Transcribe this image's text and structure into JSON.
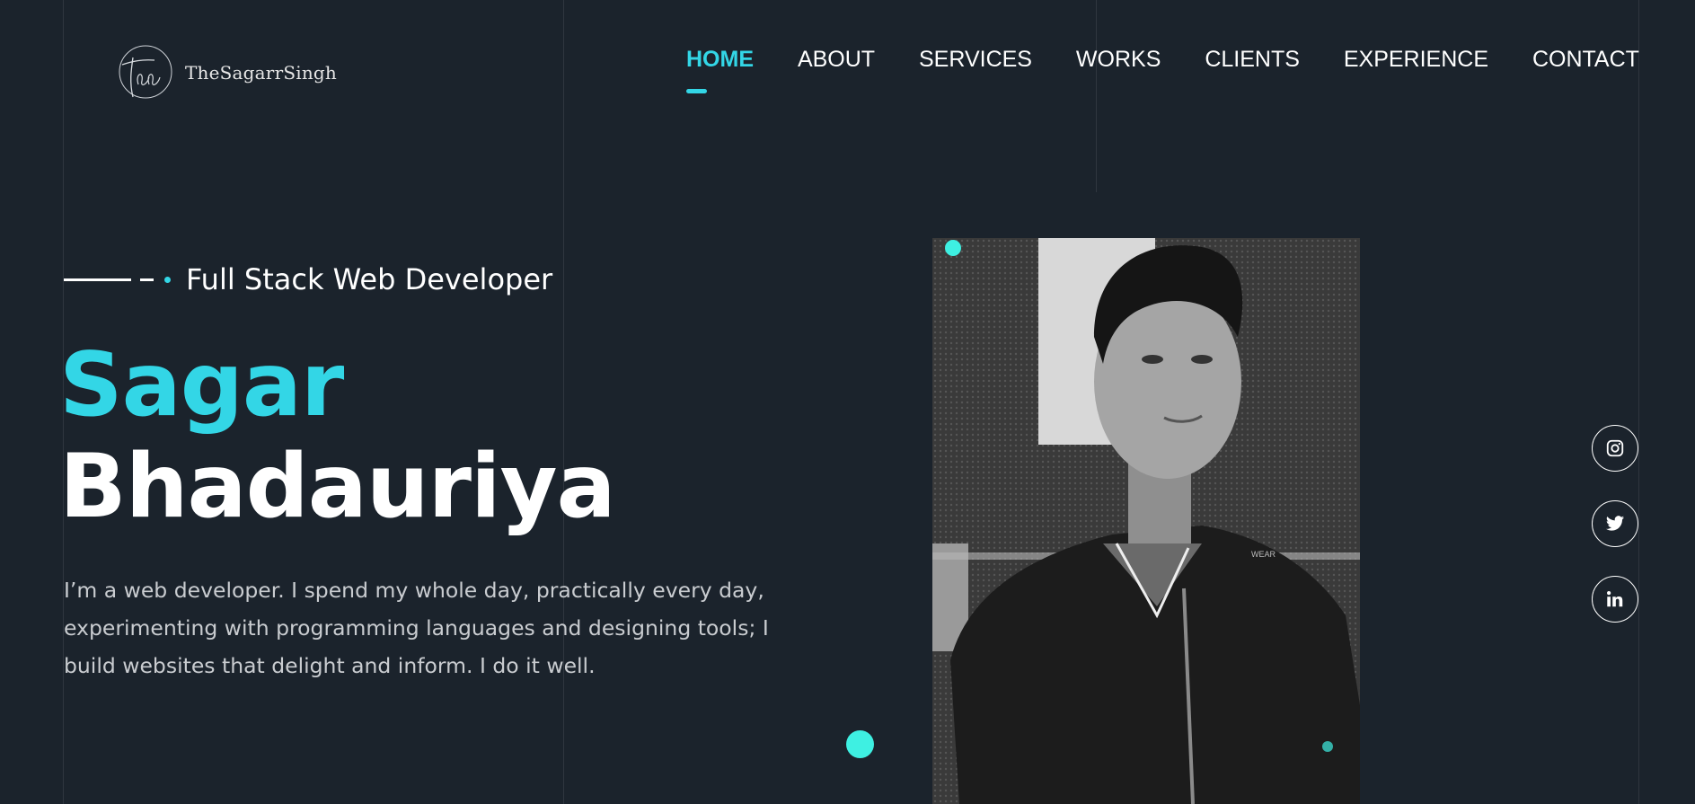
{
  "brand": {
    "name": "TheSagarrSingh",
    "logo_icon": "signature-logo-icon"
  },
  "nav": {
    "items": [
      {
        "label": "HOME",
        "active": true
      },
      {
        "label": "ABOUT",
        "active": false
      },
      {
        "label": "SERVICES",
        "active": false
      },
      {
        "label": "WORKS",
        "active": false
      },
      {
        "label": "CLIENTS",
        "active": false
      },
      {
        "label": "EXPERIENCE",
        "active": false
      },
      {
        "label": "CONTACT",
        "active": false
      }
    ]
  },
  "hero": {
    "role": "Full Stack Web Developer",
    "first_name": "Sagar",
    "last_name": "Bhadauriya",
    "bio": "I’m a web developer. I spend my whole day, practically every day, experimenting with programming languages and designing tools; I build websites that delight and inform. I do it well.",
    "photo_label": "WEAR"
  },
  "social": [
    {
      "name": "instagram",
      "icon": "instagram-icon"
    },
    {
      "name": "twitter",
      "icon": "twitter-icon"
    },
    {
      "name": "linkedin",
      "icon": "linkedin-icon"
    }
  ],
  "colors": {
    "background": "#1b232c",
    "accent": "#33d6e6",
    "dot": "#3ef0e2",
    "text": "#ffffff",
    "muted_text": "#c9ccd0"
  }
}
